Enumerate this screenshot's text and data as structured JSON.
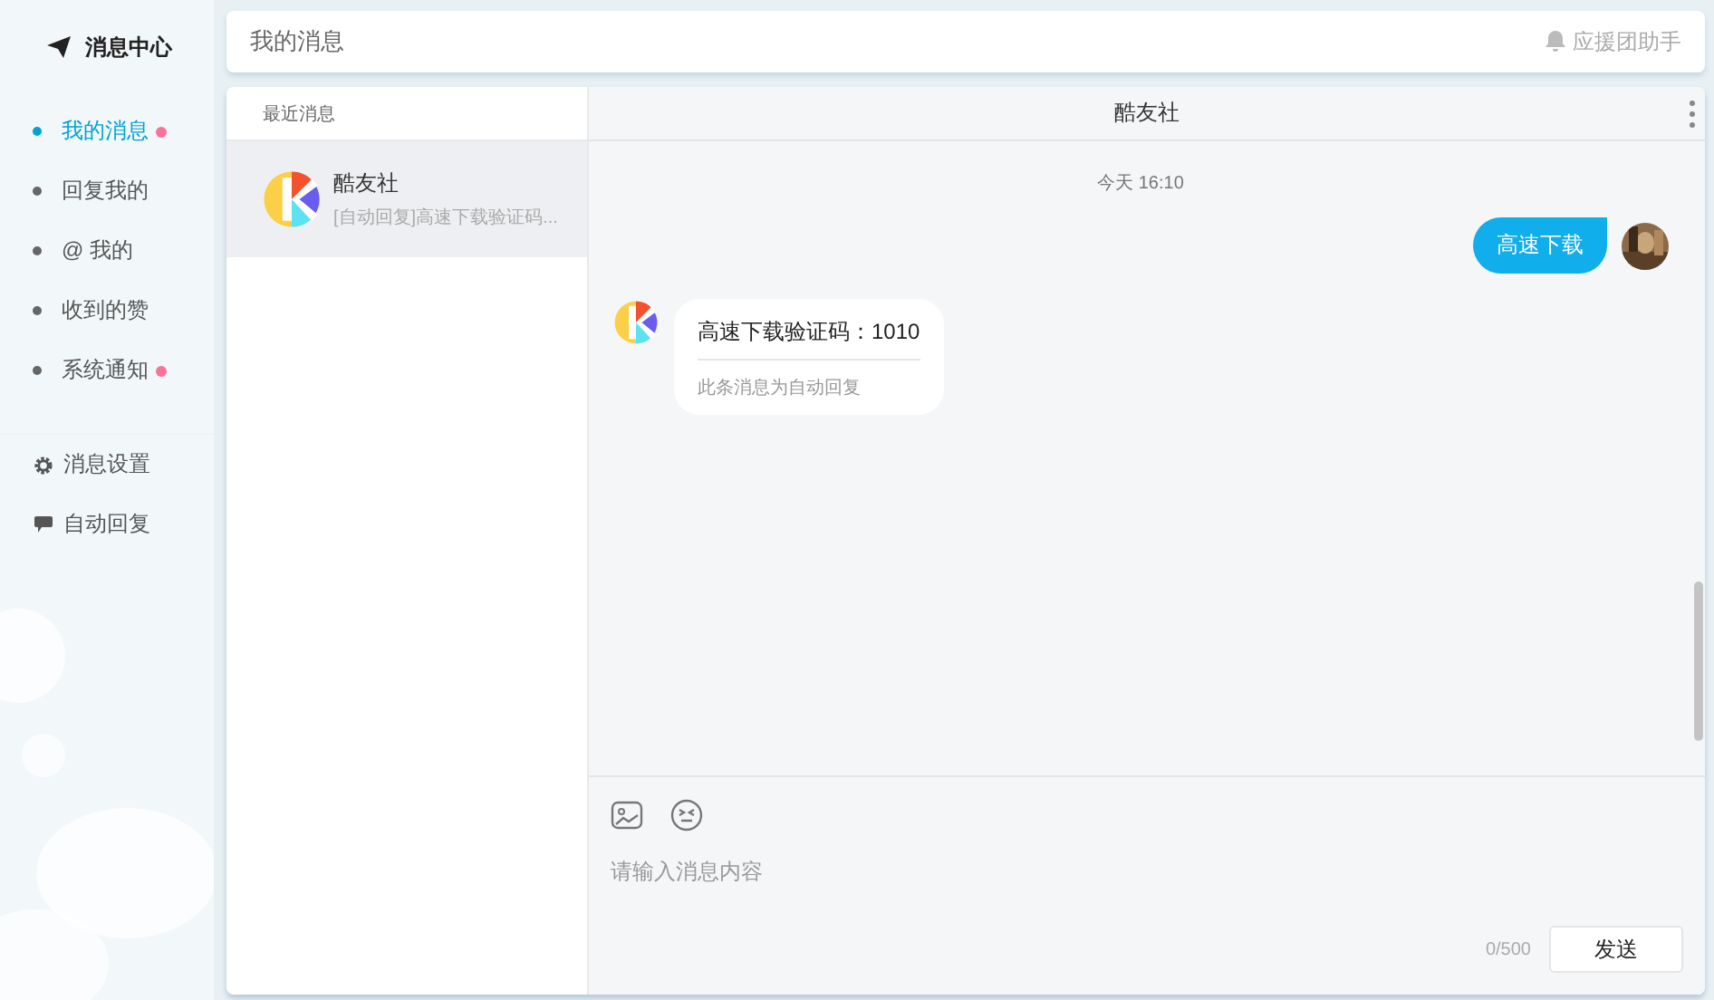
{
  "sidebar": {
    "title": "消息中心",
    "nav_items": [
      {
        "label": "我的消息",
        "selected": true,
        "unread": true
      },
      {
        "label": "回复我的",
        "selected": false,
        "unread": false
      },
      {
        "label": "@ 我的",
        "selected": false,
        "unread": false
      },
      {
        "label": "收到的赞",
        "selected": false,
        "unread": false
      },
      {
        "label": "系统通知",
        "selected": false,
        "unread": true
      }
    ],
    "settings_items": [
      {
        "label": "消息设置",
        "kind": "gear"
      },
      {
        "label": "自动回复",
        "kind": "chat"
      }
    ]
  },
  "top_bar": {
    "title": "我的消息",
    "helper": "应援团助手"
  },
  "conversation_list": {
    "heading": "最近消息",
    "items": [
      {
        "name": "酷友社",
        "preview": "[自动回复]高速下载验证码...",
        "selected": true
      }
    ]
  },
  "chat": {
    "title": "酷友社",
    "timestamp": "今天 16:10",
    "messages": [
      {
        "kind": "sent",
        "text": "高速下载"
      },
      {
        "kind": "received",
        "text": "高速下载验证码：1010",
        "note": "此条消息为自动回复"
      }
    ],
    "composer": {
      "placeholder": "请输入消息内容",
      "counter": "0/500",
      "send": "发送"
    }
  }
}
